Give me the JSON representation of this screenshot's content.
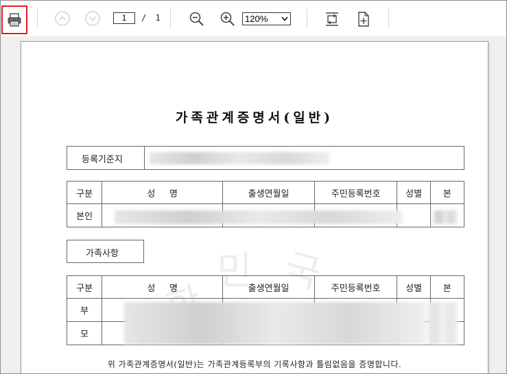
{
  "toolbar": {
    "current_page": "1",
    "page_separator": "/",
    "total_pages": "1",
    "zoom_value": "120%"
  },
  "document": {
    "title": "가족관계증명서(일반)",
    "registry_label": "등록기준지",
    "watermark_chars": [
      "대",
      "한",
      "민",
      "국"
    ],
    "principal_table": {
      "headers": [
        "구분",
        "성     명",
        "출생연월일",
        "주민등록번호",
        "성별",
        "본"
      ],
      "rows": [
        {
          "category": "본인"
        }
      ]
    },
    "family_section_label": "가족사항",
    "family_table": {
      "headers": [
        "구분",
        "성     명",
        "출생연월일",
        "주민등록번호",
        "성별",
        "본"
      ],
      "rows": [
        {
          "category": "부"
        },
        {
          "category": "모"
        }
      ]
    },
    "footer_text": "위 가족관계증명서(일반)는 가족관계등록부의 기록사항과 틀림없음을 증명합니다."
  }
}
